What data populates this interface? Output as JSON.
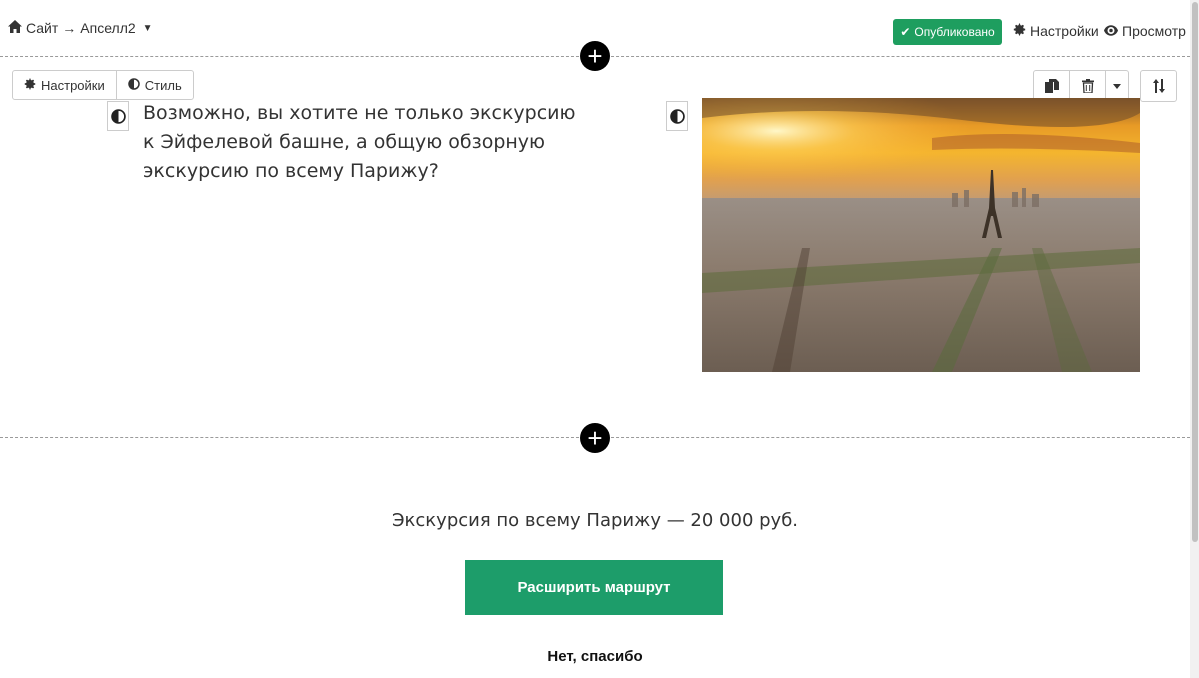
{
  "breadcrumb": {
    "site": "Сайт",
    "arrow": "→",
    "page": "Апселл2"
  },
  "header": {
    "published_label": "Опубликовано",
    "settings_label": "Настройки",
    "preview_label": "Просмотр"
  },
  "block_toolbar": {
    "settings_label": "Настройки",
    "style_label": "Стиль"
  },
  "block_text": "Возможно, вы хотите не только экскурсию к Эйфелевой башне, а общую обзорную экскурсию по всему Парижу?",
  "offer": {
    "price_text": "Экскурсия по всему Парижу — 20 000 руб.",
    "cta_label": "Расширить маршрут",
    "decline_label": "Нет, спасибо"
  },
  "colors": {
    "accent": "#1e9e5f",
    "cta": "#1d9d6a"
  }
}
